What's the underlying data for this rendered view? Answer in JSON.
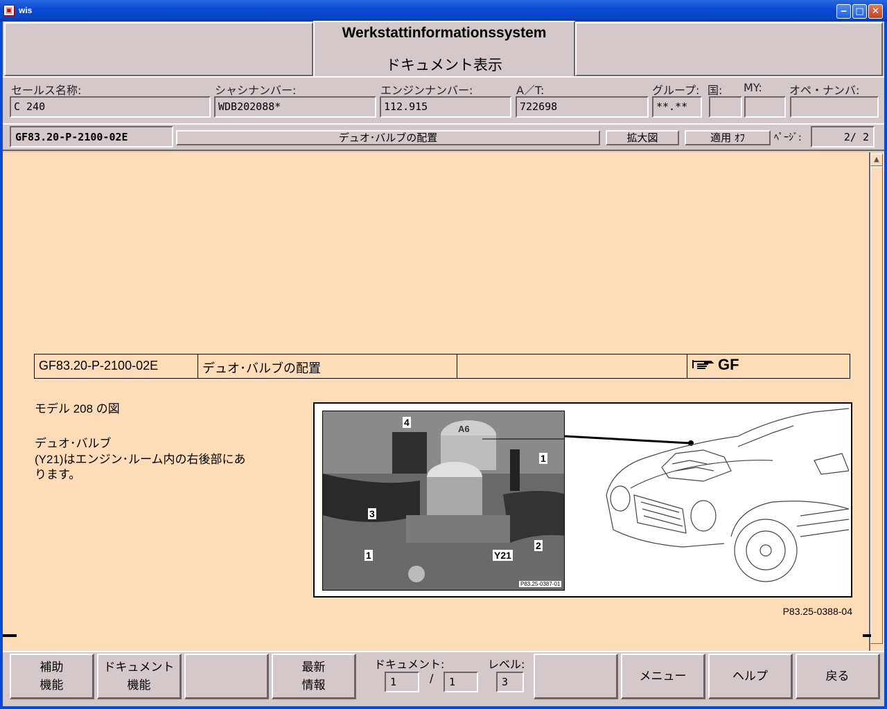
{
  "window": {
    "title": "wis"
  },
  "header": {
    "title": "Werkstattinformationssystem",
    "subtitle": "ドキュメント表示"
  },
  "info": {
    "sales_name": {
      "label": "セールス名称:",
      "value": "C 240"
    },
    "chassis": {
      "label": "シャシナンバー:",
      "value": "WDB202088*"
    },
    "engine": {
      "label": "エンジンナンバー:",
      "value": "112.915"
    },
    "at": {
      "label": "A／T:",
      "value": "722698"
    },
    "group": {
      "label": "グループ:",
      "value": "**.**"
    },
    "country": {
      "label": "国:",
      "value": ""
    },
    "my": {
      "label": "MY:",
      "value": ""
    },
    "op_number": {
      "label": "オペ・ナンバ:",
      "value": ""
    }
  },
  "docbar": {
    "doc_id": "GF83.20-P-2100-02E",
    "doc_title": "デュオ･バルブの配置",
    "zoom_button": "拡大図",
    "apply_button": "適用 ｵﾌ",
    "page_label": "ﾍﾟｰｼﾞ:",
    "page_value": "2/  2"
  },
  "document": {
    "table": {
      "id": "GF83.20-P-2100-02E",
      "title": "デュオ･バルブの配置",
      "empty": "",
      "badge": "GF"
    },
    "model_text": "モデル 208 の図",
    "desc_line1": "デュオ･バルブ",
    "desc_line2": "(Y21)はエンジン･ルーム内の右後部にあ",
    "desc_line3": "ります。",
    "figure_caption": "P83.25-0388-04",
    "photo_caption": "P83.25-0387-01",
    "photo_labels": {
      "l4": "4",
      "l1a": "1",
      "l3": "3",
      "l1b": "1",
      "y21": "Y21",
      "l2": "2",
      "a6": "A6"
    }
  },
  "bottom": {
    "help_func": [
      "補助",
      "機能"
    ],
    "doc_func": [
      "ドキュメント",
      "機能"
    ],
    "latest": [
      "最新",
      "情報"
    ],
    "doc_label": "ドキュメント:",
    "level_label": "レベル:",
    "doc_current": "1",
    "doc_sep": "/",
    "doc_total": "1",
    "level_value": "3",
    "menu": "メニュー",
    "help": "ヘルプ",
    "back": "戻る"
  }
}
